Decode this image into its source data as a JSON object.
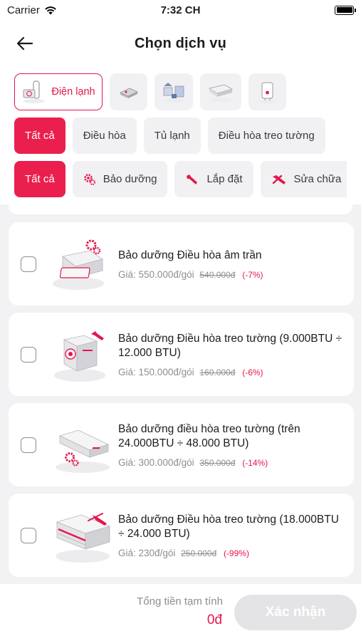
{
  "status_bar": {
    "carrier": "Carrier",
    "time": "7:32 CH"
  },
  "header": {
    "title": "Chọn dịch vụ"
  },
  "categories": [
    {
      "label": "Điện lạnh",
      "icon": "air-conditioner-icon",
      "active": true
    },
    {
      "label": "",
      "icon": "projector-icon",
      "active": false
    },
    {
      "label": "",
      "icon": "washing-machine-icon",
      "active": false
    },
    {
      "label": "",
      "icon": "split-unit-icon",
      "active": false
    },
    {
      "label": "",
      "icon": "water-heater-icon",
      "active": false
    }
  ],
  "device_filters": [
    "Tất cả",
    "Điều hòa",
    "Tủ lạnh",
    "Điều hòa treo tường"
  ],
  "service_filters": [
    "Tất cả",
    "Bảo dưỡng",
    "Lắp đặt",
    "Sửa chữa"
  ],
  "services": [
    {
      "name": "Bảo dưỡng Điều hòa âm trần",
      "price_label": "Giá:",
      "price": "550.000đ/gói",
      "old_price": "540.000đ",
      "discount": "(-7%)"
    },
    {
      "name": "Bảo dưỡng Điều hòa treo tường (9.000BTU ÷ 12.000 BTU)",
      "price_label": "Giá:",
      "price": "150.000đ/gói",
      "old_price": "160.000đ",
      "discount": "(-6%)"
    },
    {
      "name": "Bảo dưỡng điều hòa treo tường (trên 24.000BTU ÷ 48.000 BTU)",
      "price_label": "Giá:",
      "price": "300.000đ/gói",
      "old_price": "350.000đ",
      "discount": "(-14%)"
    },
    {
      "name": "Bảo dưỡng Điều hòa treo tường (18.000BTU ÷ 24.000 BTU)",
      "price_label": "Giá:",
      "price": "230đ/gói",
      "old_price": "250.000đ",
      "discount": "(-99%)"
    }
  ],
  "footer": {
    "total_label": "Tổng tiền tạm tính",
    "total_value": "0đ",
    "confirm_label": "Xác nhận"
  },
  "colors": {
    "accent": "#e5164c",
    "chip_bg": "#f1f1f3",
    "list_bg": "#f2f2f4",
    "disabled_button": "#e4e4e6"
  }
}
